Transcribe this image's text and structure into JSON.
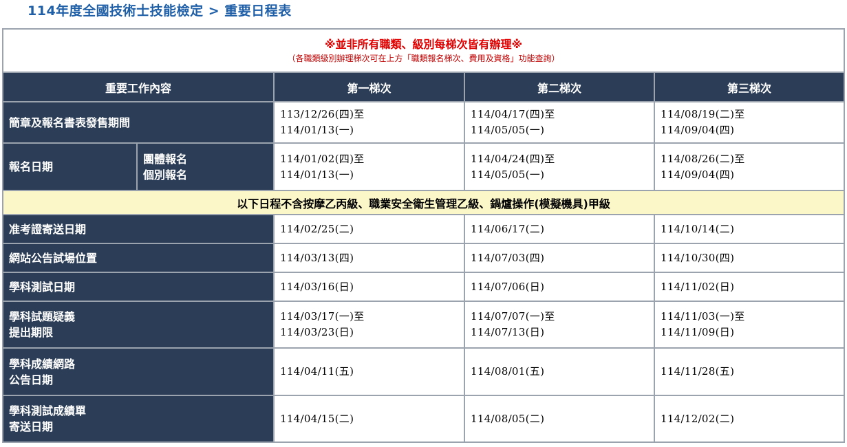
{
  "page_title": "114年度全國技術士技能檢定 > 重要日程表",
  "notice": {
    "main": "※並非所有職類、級別每梯次皆有辦理※",
    "sub": "（各職類級別辦理梯次可在上方「職類報名梯次、費用及資格」功能查詢）"
  },
  "headers": {
    "item": "重要工作內容",
    "round1": "第一梯次",
    "round2": "第二梯次",
    "round3": "第三梯次"
  },
  "rows": {
    "brochure": {
      "label": "簡章及報名書表發售期間",
      "r1": [
        "113/12/26(四)至",
        "114/01/13(一)"
      ],
      "r2": [
        "114/04/17(四)至",
        "114/05/05(一)"
      ],
      "r3": [
        "114/08/19(二)至",
        "114/09/04(四)"
      ]
    },
    "registration": {
      "label": "報名日期",
      "sub": [
        "團體報名",
        "個別報名"
      ],
      "r1": [
        "114/01/02(四)至",
        "114/01/13(一)"
      ],
      "r2": [
        "114/04/24(四)至",
        "114/05/05(一)"
      ],
      "r3": [
        "114/08/26(二)至",
        "114/09/04(四)"
      ]
    },
    "band_note": "以下日程不含按摩乙丙級、職業安全衛生管理乙級、鍋爐操作(模擬機具)甲級",
    "admission": {
      "label": "准考證寄送日期",
      "r1": "114/02/25(二)",
      "r2": "114/06/17(二)",
      "r3": "114/10/14(二)"
    },
    "venue": {
      "label": "網站公告試場位置",
      "r1": "114/03/13(四)",
      "r2": "114/07/03(四)",
      "r3": "114/10/30(四)"
    },
    "written_test": {
      "label": "學科測試日期",
      "r1": "114/03/16(日)",
      "r2": "114/07/06(日)",
      "r3": "114/11/02(日)"
    },
    "question_doubt": {
      "label": [
        "學科試題疑義",
        "提出期限"
      ],
      "r1": [
        "114/03/17(一)至",
        "114/03/23(日)"
      ],
      "r2": [
        "114/07/07(一)至",
        "114/07/13(日)"
      ],
      "r3": [
        "114/11/03(一)至",
        "114/11/09(日)"
      ]
    },
    "score_online": {
      "label": [
        "學科成績網路",
        "公告日期"
      ],
      "r1": "114/04/11(五)",
      "r2": "114/08/01(五)",
      "r3": "114/11/28(五)"
    },
    "score_mail": {
      "label": [
        "學科測試成績單",
        "寄送日期"
      ],
      "r1": "114/04/15(二)",
      "r2": "114/08/05(二)",
      "r3": "114/12/02(二)"
    }
  },
  "colors": {
    "title": "#1f5fa8",
    "header_bg": "#2c3e57",
    "notice_red": "#e00000",
    "band_bg": "#fcf7c9",
    "border": "#9aa3ae"
  }
}
